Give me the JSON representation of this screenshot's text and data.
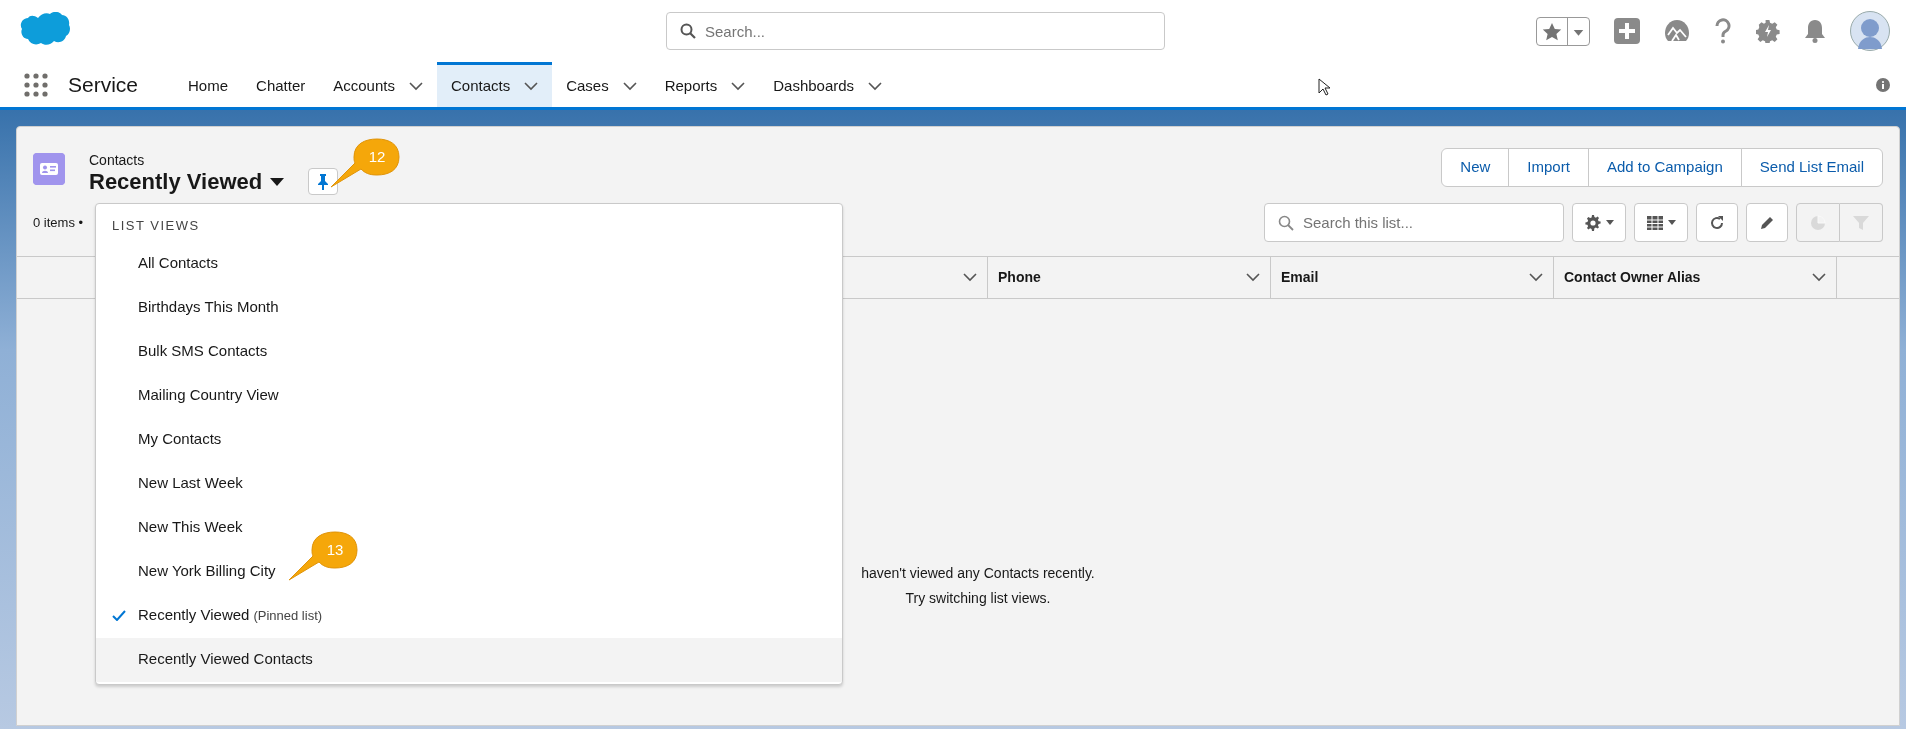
{
  "global_search": {
    "placeholder": "Search..."
  },
  "app": {
    "name": "Service"
  },
  "nav_tabs": [
    {
      "label": "Home",
      "menu": false,
      "selected": false
    },
    {
      "label": "Chatter",
      "menu": false,
      "selected": false
    },
    {
      "label": "Accounts",
      "menu": true,
      "selected": false
    },
    {
      "label": "Contacts",
      "menu": true,
      "selected": true
    },
    {
      "label": "Cases",
      "menu": true,
      "selected": false
    },
    {
      "label": "Reports",
      "menu": true,
      "selected": false
    },
    {
      "label": "Dashboards",
      "menu": true,
      "selected": false
    }
  ],
  "object": {
    "label": "Contacts",
    "list_view": "Recently Viewed"
  },
  "actions": [
    "New",
    "Import",
    "Add to Campaign",
    "Send List Email"
  ],
  "item_count": "0 items •",
  "list_search": {
    "placeholder": "Search this list..."
  },
  "toolbar_buttons": [
    {
      "kind": "settings",
      "disabled": false
    },
    {
      "kind": "columns",
      "disabled": false
    },
    {
      "kind": "refresh",
      "disabled": false
    },
    {
      "kind": "edit",
      "disabled": false
    },
    {
      "kind": "chart",
      "disabled": true
    },
    {
      "kind": "filter",
      "disabled": true
    }
  ],
  "table": {
    "columns": [
      {
        "label": "Phone"
      },
      {
        "label": "Email"
      },
      {
        "label": "Contact Owner Alias"
      }
    ]
  },
  "empty_message": [
    "haven't viewed any Contacts recently.",
    "Try switching list views."
  ],
  "list_views_menu": {
    "heading": "LIST VIEWS",
    "items": [
      {
        "label": "All Contacts",
        "selected": false,
        "highlighted": false
      },
      {
        "label": "Birthdays This Month",
        "selected": false,
        "highlighted": false
      },
      {
        "label": "Bulk SMS Contacts",
        "selected": false,
        "highlighted": false
      },
      {
        "label": "Mailing Country View",
        "selected": false,
        "highlighted": false
      },
      {
        "label": "My Contacts",
        "selected": false,
        "highlighted": false
      },
      {
        "label": "New Last Week",
        "selected": false,
        "highlighted": false
      },
      {
        "label": "New This Week",
        "selected": false,
        "highlighted": false
      },
      {
        "label": "New York Billing City",
        "selected": false,
        "highlighted": false
      },
      {
        "label": "Recently Viewed",
        "note": "(Pinned list)",
        "selected": true,
        "highlighted": false
      },
      {
        "label": "Recently Viewed Contacts",
        "selected": false,
        "highlighted": true
      }
    ]
  },
  "callouts": [
    {
      "label": "12"
    },
    {
      "label": "13"
    }
  ]
}
